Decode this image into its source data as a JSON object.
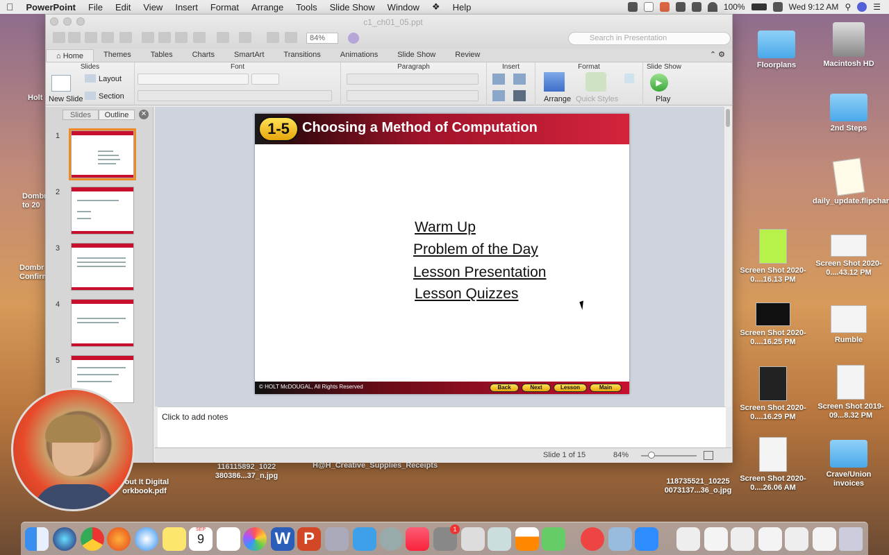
{
  "menubar": {
    "app": "PowerPoint",
    "items": [
      "File",
      "Edit",
      "View",
      "Insert",
      "Format",
      "Arrange",
      "Tools",
      "Slide Show",
      "Window",
      "Help"
    ],
    "battery": "100%",
    "clock": "Wed 9:12 AM"
  },
  "window": {
    "title": "c1_ch01_05.ppt",
    "zoom": "84%",
    "search_placeholder": "Search in Presentation"
  },
  "ribbon": {
    "tabs": [
      "Home",
      "Themes",
      "Tables",
      "Charts",
      "SmartArt",
      "Transitions",
      "Animations",
      "Slide Show",
      "Review"
    ],
    "active_tab": "Home",
    "groups": {
      "slides": "Slides",
      "font": "Font",
      "paragraph": "Paragraph",
      "insert": "Insert",
      "format": "Format",
      "slideshow": "Slide Show"
    },
    "new_slide": "New Slide",
    "layout": "Layout",
    "section": "Section",
    "arrange": "Arrange",
    "quick_styles": "Quick Styles",
    "play": "Play"
  },
  "left_pane": {
    "tabs": [
      "Slides",
      "Outline"
    ],
    "thumbs": [
      {
        "num": "1",
        "title": "Choosing a Method of Computation",
        "lines": [
          "Warm Up",
          "Problem of the Day",
          "Lesson Presentation",
          "Lesson Quizzes"
        ]
      },
      {
        "num": "2",
        "title": "Choosing a Method of Computation",
        "lines": [
          "Warm Up"
        ]
      },
      {
        "num": "3",
        "title": "Choosing a Method of Computation",
        "lines": [
          "Problem of the Day"
        ]
      },
      {
        "num": "4",
        "title": "Choosing a Method of Computation",
        "lines": [
          "Learn to choose an appropriate method of computation and justify your choice."
        ]
      },
      {
        "num": "5",
        "title": "Choosing a Method of Computation",
        "lines": [
          "Additional Example 1a"
        ]
      }
    ]
  },
  "slide": {
    "badge": "1-5",
    "title": "Choosing a Method of Computation",
    "links": [
      "Warm Up",
      "Problem of the Day",
      "Lesson Presentation",
      "Lesson Quizzes"
    ],
    "copyright": "© HOLT McDOUGAL, All Rights Reserved",
    "nav": [
      "Back",
      "Next",
      "Lesson",
      "Main"
    ]
  },
  "notes_placeholder": "Click to add notes",
  "status": {
    "slide_info": "Slide 1 of 15",
    "zoom": "84%"
  },
  "desktop": {
    "right_icons": [
      {
        "label": "Floorplans",
        "kind": "folder"
      },
      {
        "label": "Macintosh HD",
        "kind": "drive"
      },
      {
        "label": "2nd Steps",
        "kind": "folder"
      },
      {
        "label": "daily_update.flipchart",
        "kind": "file"
      },
      {
        "label": "Screen Shot 2020-0....16.13 PM",
        "kind": "image"
      },
      {
        "label": "Screen Shot 2020-0....43.12 PM",
        "kind": "image"
      },
      {
        "label": "Screen Shot 2020-0....16.25 PM",
        "kind": "image"
      },
      {
        "label": "Rumble",
        "kind": "file"
      },
      {
        "label": "Screen Shot 2020-0....16.29 PM",
        "kind": "image"
      },
      {
        "label": "Screen Shot 2019-09...8.32 PM",
        "kind": "image"
      },
      {
        "label": "Screen Shot 2020-0....26.06 AM",
        "kind": "image"
      },
      {
        "label": "Crave/Union invoices",
        "kind": "folder"
      }
    ],
    "bottom_labels": [
      "bout It Digital orkbook.pdf",
      "116115892_1022 380386...37_n.jpg",
      "H@H_Creative_Supplies_Receipts",
      "118735521_10225 0073137...36_o.jpg"
    ],
    "left_labels": [
      "Holt",
      "Dombr to 20",
      "Dombr Confirm"
    ]
  },
  "dock": {
    "calendar_month": "SEP",
    "calendar_day": "9",
    "badge": "1"
  }
}
